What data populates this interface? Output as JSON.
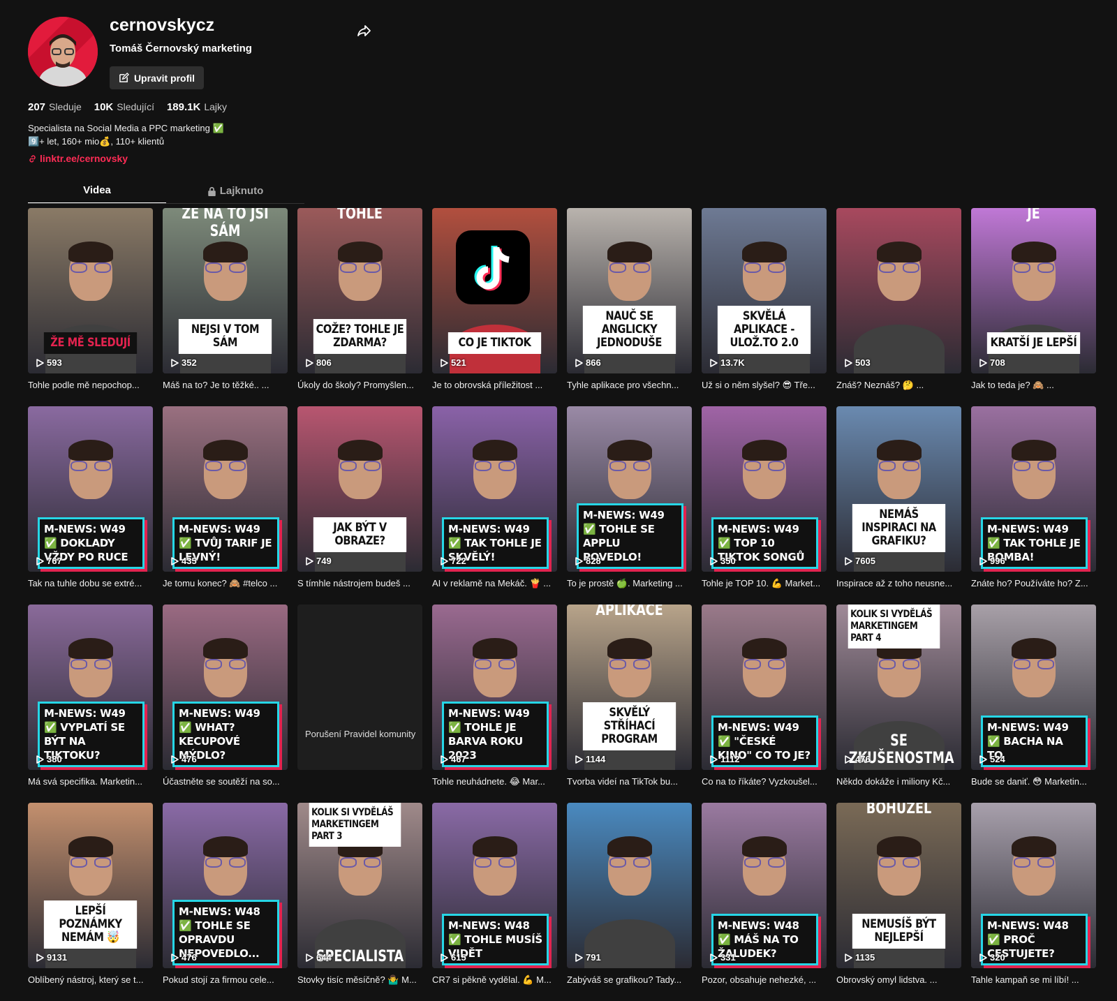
{
  "profile": {
    "username": "cernovskycz",
    "fullname": "Tomáš Černovský marketing",
    "edit_label": "Upravit profil",
    "stats": [
      {
        "value": "207",
        "label": "Sleduje"
      },
      {
        "value": "10K",
        "label": "Sledující"
      },
      {
        "value": "189.1K",
        "label": "Lajky"
      }
    ],
    "bio_line1": "Specialista na Social Media a PPC marketing ✅",
    "bio_line2": "9️⃣+ let, 160+ mio💰, 110+ klientů",
    "link": "linktr.ee/cernovsky"
  },
  "tabs": {
    "videos": "Videa",
    "liked": "Lajknuto"
  },
  "colors": {
    "accent": "#fe2c55",
    "news_border": "#26d6e6",
    "news_shadow": "#e3234f"
  },
  "videos": [
    {
      "views": "593",
      "desc": "Tohle podle mě nepochop...",
      "caption": "ŽE MĚ SLEDUJÍ",
      "style": "screen",
      "bg": "#8a7a66"
    },
    {
      "views": "352",
      "desc": "Máš na to? Je to těžké.. ...",
      "caption": "NEJSI V TOM SÁM",
      "top": "ŽE NA TO JSI SÁM",
      "style": "caption",
      "bg": "#7d8a7a"
    },
    {
      "views": "806",
      "desc": "Úkoly do školy? Promyšlen...",
      "caption": "COŽE? TOHLE JE ZDARMA?",
      "top": "TOHLE",
      "style": "caption",
      "bg": "#9b5a5a"
    },
    {
      "views": "521",
      "desc": "Je to obrovská příležitost ...",
      "caption": "CO JE TIKTOK",
      "style": "tiktok",
      "bg": "#b24f3e"
    },
    {
      "views": "866",
      "desc": "Tyhle aplikace pro všechn...",
      "caption": "NAUČ SE ANGLICKY JEDNODUŠE",
      "style": "caption",
      "bg": "#b9b3ad"
    },
    {
      "views": "13.7K",
      "desc": "Už si o něm slyšel? 😎 Tře...",
      "caption": "SKVĚLÁ APLIKACE - ULOŽ.TO 2.0",
      "style": "caption",
      "bg": "#6e7a94"
    },
    {
      "views": "503",
      "desc": "Znáš? Neznáš? 🤔 ...",
      "caption": "",
      "style": "glitch",
      "bg": "#a8495e"
    },
    {
      "views": "708",
      "desc": "Jak to teda je? 🙈 ...",
      "caption": "KRATŠÍ JE LEPŠÍ",
      "top": "JE",
      "style": "caption",
      "bg": "#c078d6"
    },
    {
      "views": "767",
      "desc": "Tak na tuhle dobu se extré...",
      "news": "M-NEWS: W49 ✅ DOKLADY VŽDY PO RUCE",
      "style": "news",
      "bg": "#8a6aa0"
    },
    {
      "views": "435",
      "desc": "Je tomu konec? 🙈 #telco ...",
      "news": "M-NEWS: W49 ✅ TVŮJ TARIF JE LEVNÝ!",
      "style": "news",
      "bg": "#9a7080"
    },
    {
      "views": "749",
      "desc": "S tímhle nástrojem budeš ...",
      "caption": "JAK BÝT V OBRAZE?",
      "style": "caption",
      "bg": "#b85670"
    },
    {
      "views": "722",
      "desc": "AI v reklamě na Mekáč. 🍟 ...",
      "news": "M-NEWS: W49 ✅ TAK TOHLE JE SKVĚLÝ!",
      "style": "news",
      "bg": "#8a62a8"
    },
    {
      "views": "828",
      "desc": "To je prostě 🍏. Marketing ...",
      "news": "M-NEWS: W49 ✅ TOHLE SE APPLU POVEDLO!",
      "style": "news",
      "bg": "#9a8aa6"
    },
    {
      "views": "350",
      "desc": "Tohle je TOP 10. 💪 Market...",
      "news": "M-NEWS: W49 ✅ TOP 10 TIKTOK SONGŮ",
      "style": "news",
      "bg": "#a064a6"
    },
    {
      "views": "7605",
      "desc": "Inspirace až z toho neusne...",
      "caption": "NEMÁŠ INSPIRACI NA GRAFIKU?",
      "style": "caption",
      "bg": "#6a8ab0"
    },
    {
      "views": "996",
      "desc": "Znáte ho? Používáte ho? Z...",
      "news": "M-NEWS: W49 ✅ TAK TOHLE JE BOMBA!",
      "style": "news",
      "bg": "#9a70a0"
    },
    {
      "views": "380",
      "desc": "Má svá specifika. Marketin...",
      "news": "M-NEWS: W49 ✅ VYPLATÍ SE BÝT NA TIKTOKU?",
      "style": "news",
      "bg": "#8a6a9a"
    },
    {
      "views": "476",
      "desc": "Účastněte se soutěží na so...",
      "news": "M-NEWS: W49 ✅ WHAT? KECUPOVÉ MÝDLO?",
      "style": "news",
      "bg": "#9a6a82"
    },
    {
      "views": "",
      "desc": "",
      "removed": "Porušení Pravidel komunity",
      "style": "removed",
      "bg": "#1e1e1e"
    },
    {
      "views": "467",
      "desc": "Tohle neuhádnete. 😂 Mar...",
      "news": "M-NEWS: W49 ✅ TOHLE JE BARVA ROKU 2023",
      "style": "news",
      "bg": "#9a6a90"
    },
    {
      "views": "1144",
      "desc": "Tvorba videí na TikTok bu...",
      "caption": "SKVĚLÝ STŘÍHACÍ PROGRAM",
      "top": "APLIKACE",
      "style": "caption",
      "bg": "#b8a48a"
    },
    {
      "views": "1112",
      "desc": "Co na to říkáte? Vyzkoušel...",
      "news": "M-NEWS: W49 ✅ \"ČESKÉ KINO\" CO TO JE?",
      "style": "news",
      "bg": "#9a7a8a"
    },
    {
      "views": "476",
      "desc": "Někdo dokáže i miliony Kč...",
      "caption": "KOLIK SI VYDĚLÁŠ MARKETINGEM PART 4",
      "bottom": "SE ZKUŠENOSTMA",
      "style": "corner",
      "bg": "#a08a98"
    },
    {
      "views": "524",
      "desc": "Bude se daniť. 😳 Marketin...",
      "news": "M-NEWS: W49 ✅ BACHA NA TO",
      "style": "news",
      "bg": "#a8a0a8"
    },
    {
      "views": "9131",
      "desc": "Oblíbený nástroj, který se t...",
      "caption": "LEPŠÍ POZNÁMKY NEMÁM 🤯",
      "style": "caption",
      "bg": "#c4906e"
    },
    {
      "views": "476",
      "desc": "Pokud stojí za firmou cele...",
      "news": "M-NEWS: W48 ✅ TOHLE SE OPRAVDU NEPOVEDLO...",
      "style": "news",
      "bg": "#8a6aa6"
    },
    {
      "views": "644",
      "desc": "Stovky tisíc měsíčně? 🤷‍♂️ M...",
      "caption": "KOLIK SI VYDĚLÁŠ MARKETINGEM PART 3",
      "bottom": "SPECIALISTA",
      "style": "corner",
      "bg": "#a08a8a"
    },
    {
      "views": "615",
      "desc": "CR7 si pěkně vydělal. 💪 M...",
      "news": "M-NEWS: W48 ✅ TOHLE MUSÍŠ VIDĚT",
      "style": "news",
      "bg": "#8a6aa6"
    },
    {
      "views": "791",
      "desc": "Zabýváš se grafikou? Tady...",
      "caption": "",
      "style": "glitch",
      "bg": "#4a8ac0"
    },
    {
      "views": "331",
      "desc": "Pozor, obsahuje nehezké, ...",
      "news": "M-NEWS: W48 ✅ MÁŠ NA TO ŽALUDEK?",
      "style": "news",
      "bg": "#9a7aa0"
    },
    {
      "views": "1135",
      "desc": "Obrovský omyl lidstva. ...",
      "caption": "NEMUSÍŠ BÝT NEJLEPŠÍ",
      "top": "BOHUŽEL",
      "style": "caption",
      "bg": "#7a6a56"
    },
    {
      "views": "320",
      "desc": "Tahle kampaň se mi líbí! ...",
      "news": "M-NEWS: W48 ✅ PROČ CESTUJETE?",
      "style": "news",
      "bg": "#a8a0ac"
    }
  ]
}
